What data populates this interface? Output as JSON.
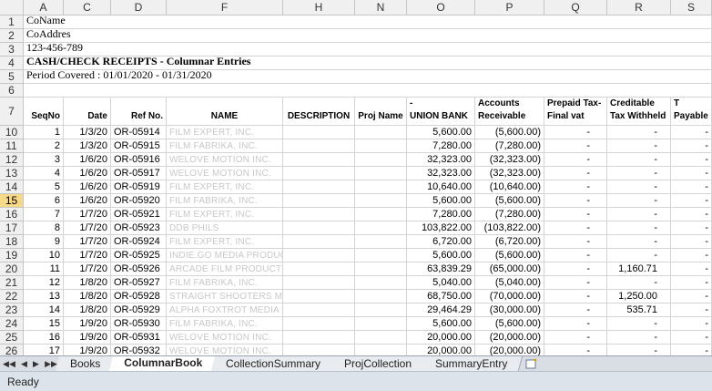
{
  "columns": [
    "A",
    "C",
    "D",
    "F",
    "H",
    "N",
    "O",
    "P",
    "Q",
    "R",
    "S"
  ],
  "top_rows": [
    {
      "num": "1",
      "a": "CoName"
    },
    {
      "num": "2",
      "a": "CoAddres"
    },
    {
      "num": "3",
      "a": "123-456-789"
    },
    {
      "num": "4",
      "a": "CASH/CHECK RECEIPTS - Columnar Entries"
    },
    {
      "num": "5",
      "a": "Period Covered :  01/01/2020 - 01/31/2020"
    },
    {
      "num": "6",
      "a": ""
    }
  ],
  "header_row": {
    "num": "7",
    "seqno": "SeqNo",
    "date": "Date",
    "refno": "Ref No.",
    "name": "NAME",
    "description": "DESCRIPTION",
    "projname": "Proj Name",
    "cash1": "Cash in Bank -",
    "cash2": "UNION BANK",
    "ar1": "Accounts",
    "ar2": "Receivable",
    "prepaid1": "Prepaid Tax-",
    "prepaid2": "Final vat",
    "cwt1": "Creditable",
    "cwt2": "Tax Withheld",
    "out1": "Output T",
    "out2": "Payable"
  },
  "data_rows": [
    {
      "num": "10",
      "seq": "1",
      "date": "1/3/20",
      "ref": "OR-05914",
      "name": "FILM EXPERT, INC.",
      "cash": "5,600.00",
      "ar": "(5,600.00)",
      "pp": "-",
      "cwt": "-",
      "out": "-"
    },
    {
      "num": "11",
      "seq": "2",
      "date": "1/3/20",
      "ref": "OR-05915",
      "name": "FILM FABRIKA, INC.",
      "cash": "7,280.00",
      "ar": "(7,280.00)",
      "pp": "-",
      "cwt": "-",
      "out": "-"
    },
    {
      "num": "12",
      "seq": "3",
      "date": "1/6/20",
      "ref": "OR-05916",
      "name": "WELOVE MOTION INC.",
      "cash": "32,323.00",
      "ar": "(32,323.00)",
      "pp": "-",
      "cwt": "-",
      "out": "-"
    },
    {
      "num": "13",
      "seq": "4",
      "date": "1/6/20",
      "ref": "OR-05917",
      "name": "WELOVE MOTION INC.",
      "cash": "32,323.00",
      "ar": "(32,323.00)",
      "pp": "-",
      "cwt": "-",
      "out": "-"
    },
    {
      "num": "14",
      "seq": "5",
      "date": "1/6/20",
      "ref": "OR-05919",
      "name": "FILM EXPERT, INC.",
      "cash": "10,640.00",
      "ar": "(10,640.00)",
      "pp": "-",
      "cwt": "-",
      "out": "-"
    },
    {
      "num": "15",
      "seq": "6",
      "date": "1/6/20",
      "ref": "OR-05920",
      "name": "FILM FABRIKA, INC.",
      "cash": "5,600.00",
      "ar": "(5,600.00)",
      "pp": "-",
      "cwt": "-",
      "out": "-"
    },
    {
      "num": "16",
      "seq": "7",
      "date": "1/7/20",
      "ref": "OR-05921",
      "name": "FILM EXPERT, INC.",
      "cash": "7,280.00",
      "ar": "(7,280.00)",
      "pp": "-",
      "cwt": "-",
      "out": "-"
    },
    {
      "num": "17",
      "seq": "8",
      "date": "1/7/20",
      "ref": "OR-05923",
      "name": "DDB PHILS",
      "cash": "103,822.00",
      "ar": "(103,822.00)",
      "pp": "-",
      "cwt": "-",
      "out": "-"
    },
    {
      "num": "18",
      "seq": "9",
      "date": "1/7/20",
      "ref": "OR-05924",
      "name": "FILM EXPERT, INC.",
      "cash": "6,720.00",
      "ar": "(6,720.00)",
      "pp": "-",
      "cwt": "-",
      "out": "-"
    },
    {
      "num": "19",
      "seq": "10",
      "date": "1/7/20",
      "ref": "OR-05925",
      "name": "INDIE.GO MEDIA PRODUCTI",
      "cash": "5,600.00",
      "ar": "(5,600.00)",
      "pp": "-",
      "cwt": "-",
      "out": "-"
    },
    {
      "num": "20",
      "seq": "11",
      "date": "1/7/20",
      "ref": "OR-05926",
      "name": "ARCADE FILM PRODUCTION",
      "cash": "63,839.29",
      "ar": "(65,000.00)",
      "pp": "-",
      "cwt": "1,160.71",
      "out": "-"
    },
    {
      "num": "21",
      "seq": "12",
      "date": "1/8/20",
      "ref": "OR-05927",
      "name": "FILM FABRIKA, INC.",
      "cash": "5,040.00",
      "ar": "(5,040.00)",
      "pp": "-",
      "cwt": "-",
      "out": "-"
    },
    {
      "num": "22",
      "seq": "13",
      "date": "1/8/20",
      "ref": "OR-05928",
      "name": "STRAIGHT SHOOTERS MEDIA",
      "cash": "68,750.00",
      "ar": "(70,000.00)",
      "pp": "-",
      "cwt": "1,250.00",
      "out": "-"
    },
    {
      "num": "23",
      "seq": "14",
      "date": "1/8/20",
      "ref": "OR-05929",
      "name": "ALPHA FOXTROT MEDIA INC.",
      "cash": "29,464.29",
      "ar": "(30,000.00)",
      "pp": "-",
      "cwt": "535.71",
      "out": "-"
    },
    {
      "num": "24",
      "seq": "15",
      "date": "1/9/20",
      "ref": "OR-05930",
      "name": "FILM FABRIKA, INC.",
      "cash": "5,600.00",
      "ar": "(5,600.00)",
      "pp": "-",
      "cwt": "-",
      "out": "-"
    },
    {
      "num": "25",
      "seq": "16",
      "date": "1/9/20",
      "ref": "OR-05931",
      "name": "WELOVE MOTION INC.",
      "cash": "20,000.00",
      "ar": "(20,000.00)",
      "pp": "-",
      "cwt": "-",
      "out": "-"
    },
    {
      "num": "26",
      "seq": "17",
      "date": "1/9/20",
      "ref": "OR-05932",
      "name": "WELOVE MOTION INC.",
      "cash": "20,000.00",
      "ar": "(20,000.00)",
      "pp": "-",
      "cwt": "-",
      "out": "-"
    }
  ],
  "selected_row": "15",
  "tabs": [
    "Books",
    "ColumnarBook",
    "CollectionSummary",
    "ProjCollection",
    "SummaryEntry"
  ],
  "active_tab": "ColumnarBook",
  "status": "Ready",
  "colors": {
    "header_bg": "#f0f0f0",
    "selected_row": "#f8d98a",
    "gridline": "#d4d4d4",
    "statusbar": "#dde3ea"
  }
}
